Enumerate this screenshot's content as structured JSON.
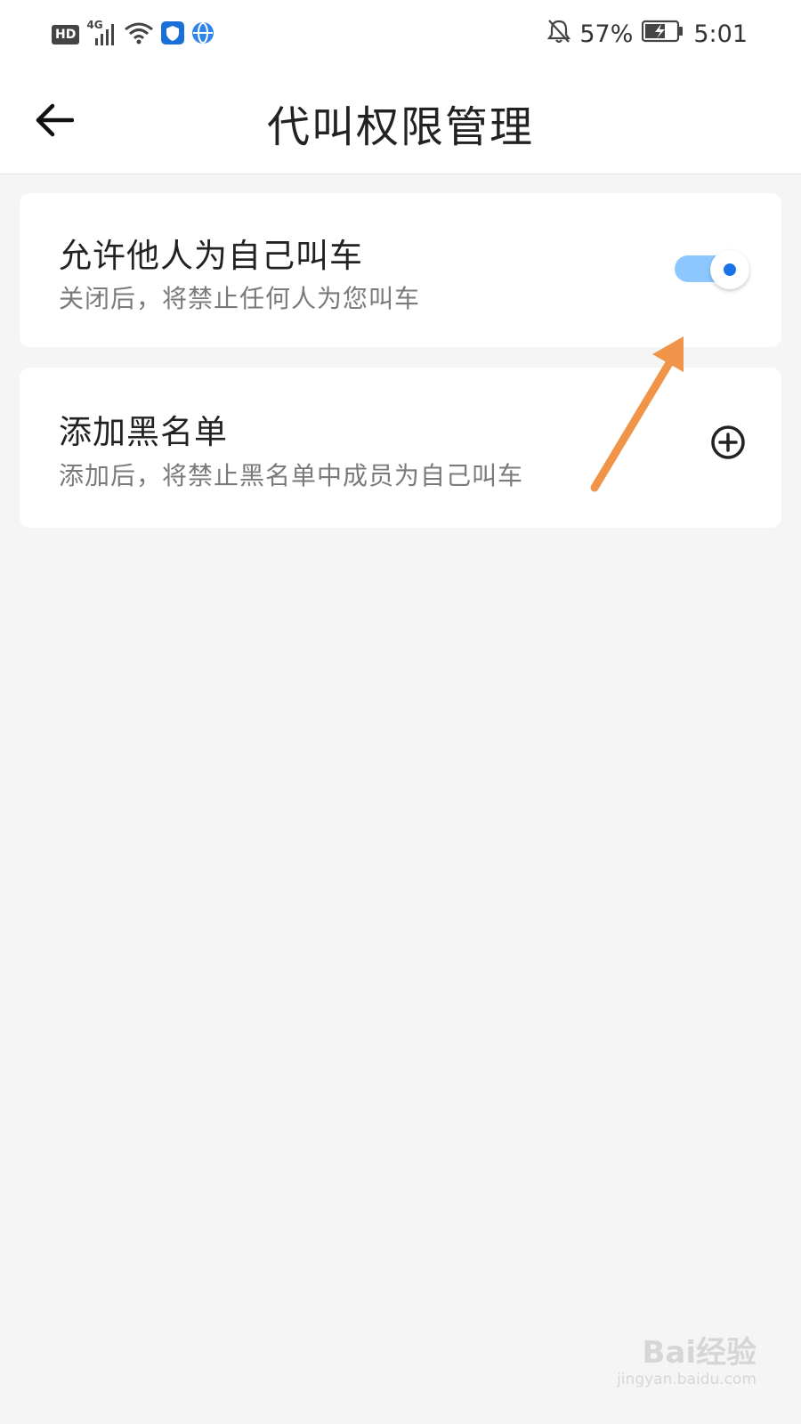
{
  "status_bar": {
    "hd_label": "HD",
    "network_label": "4G",
    "battery_percent": "57%",
    "time": "5:01",
    "icons": [
      "hd-icon",
      "signal-icon",
      "wifi-icon",
      "shield-app-icon",
      "browser-app-icon",
      "bell-off-icon",
      "battery-charging-icon"
    ]
  },
  "header": {
    "title": "代叫权限管理",
    "back_icon": "back-arrow-icon"
  },
  "settings": {
    "allow_others": {
      "title": "允许他人为自己叫车",
      "subtitle": "关闭后，将禁止任何人为您叫车",
      "enabled": true
    },
    "blacklist": {
      "title": "添加黑名单",
      "subtitle": "添加后，将禁止黑名单中成员为自己叫车",
      "action_icon": "add-circle-icon"
    }
  },
  "annotation": {
    "color": "#f0944a",
    "points_to": "allow-others-toggle"
  },
  "watermark": {
    "text": "Bai经验",
    "subtext": "jingyan.baidu.com"
  },
  "colors": {
    "accent": "#1a73e8",
    "toggle_track": "#8cc8ff",
    "background": "#f5f5f5"
  }
}
